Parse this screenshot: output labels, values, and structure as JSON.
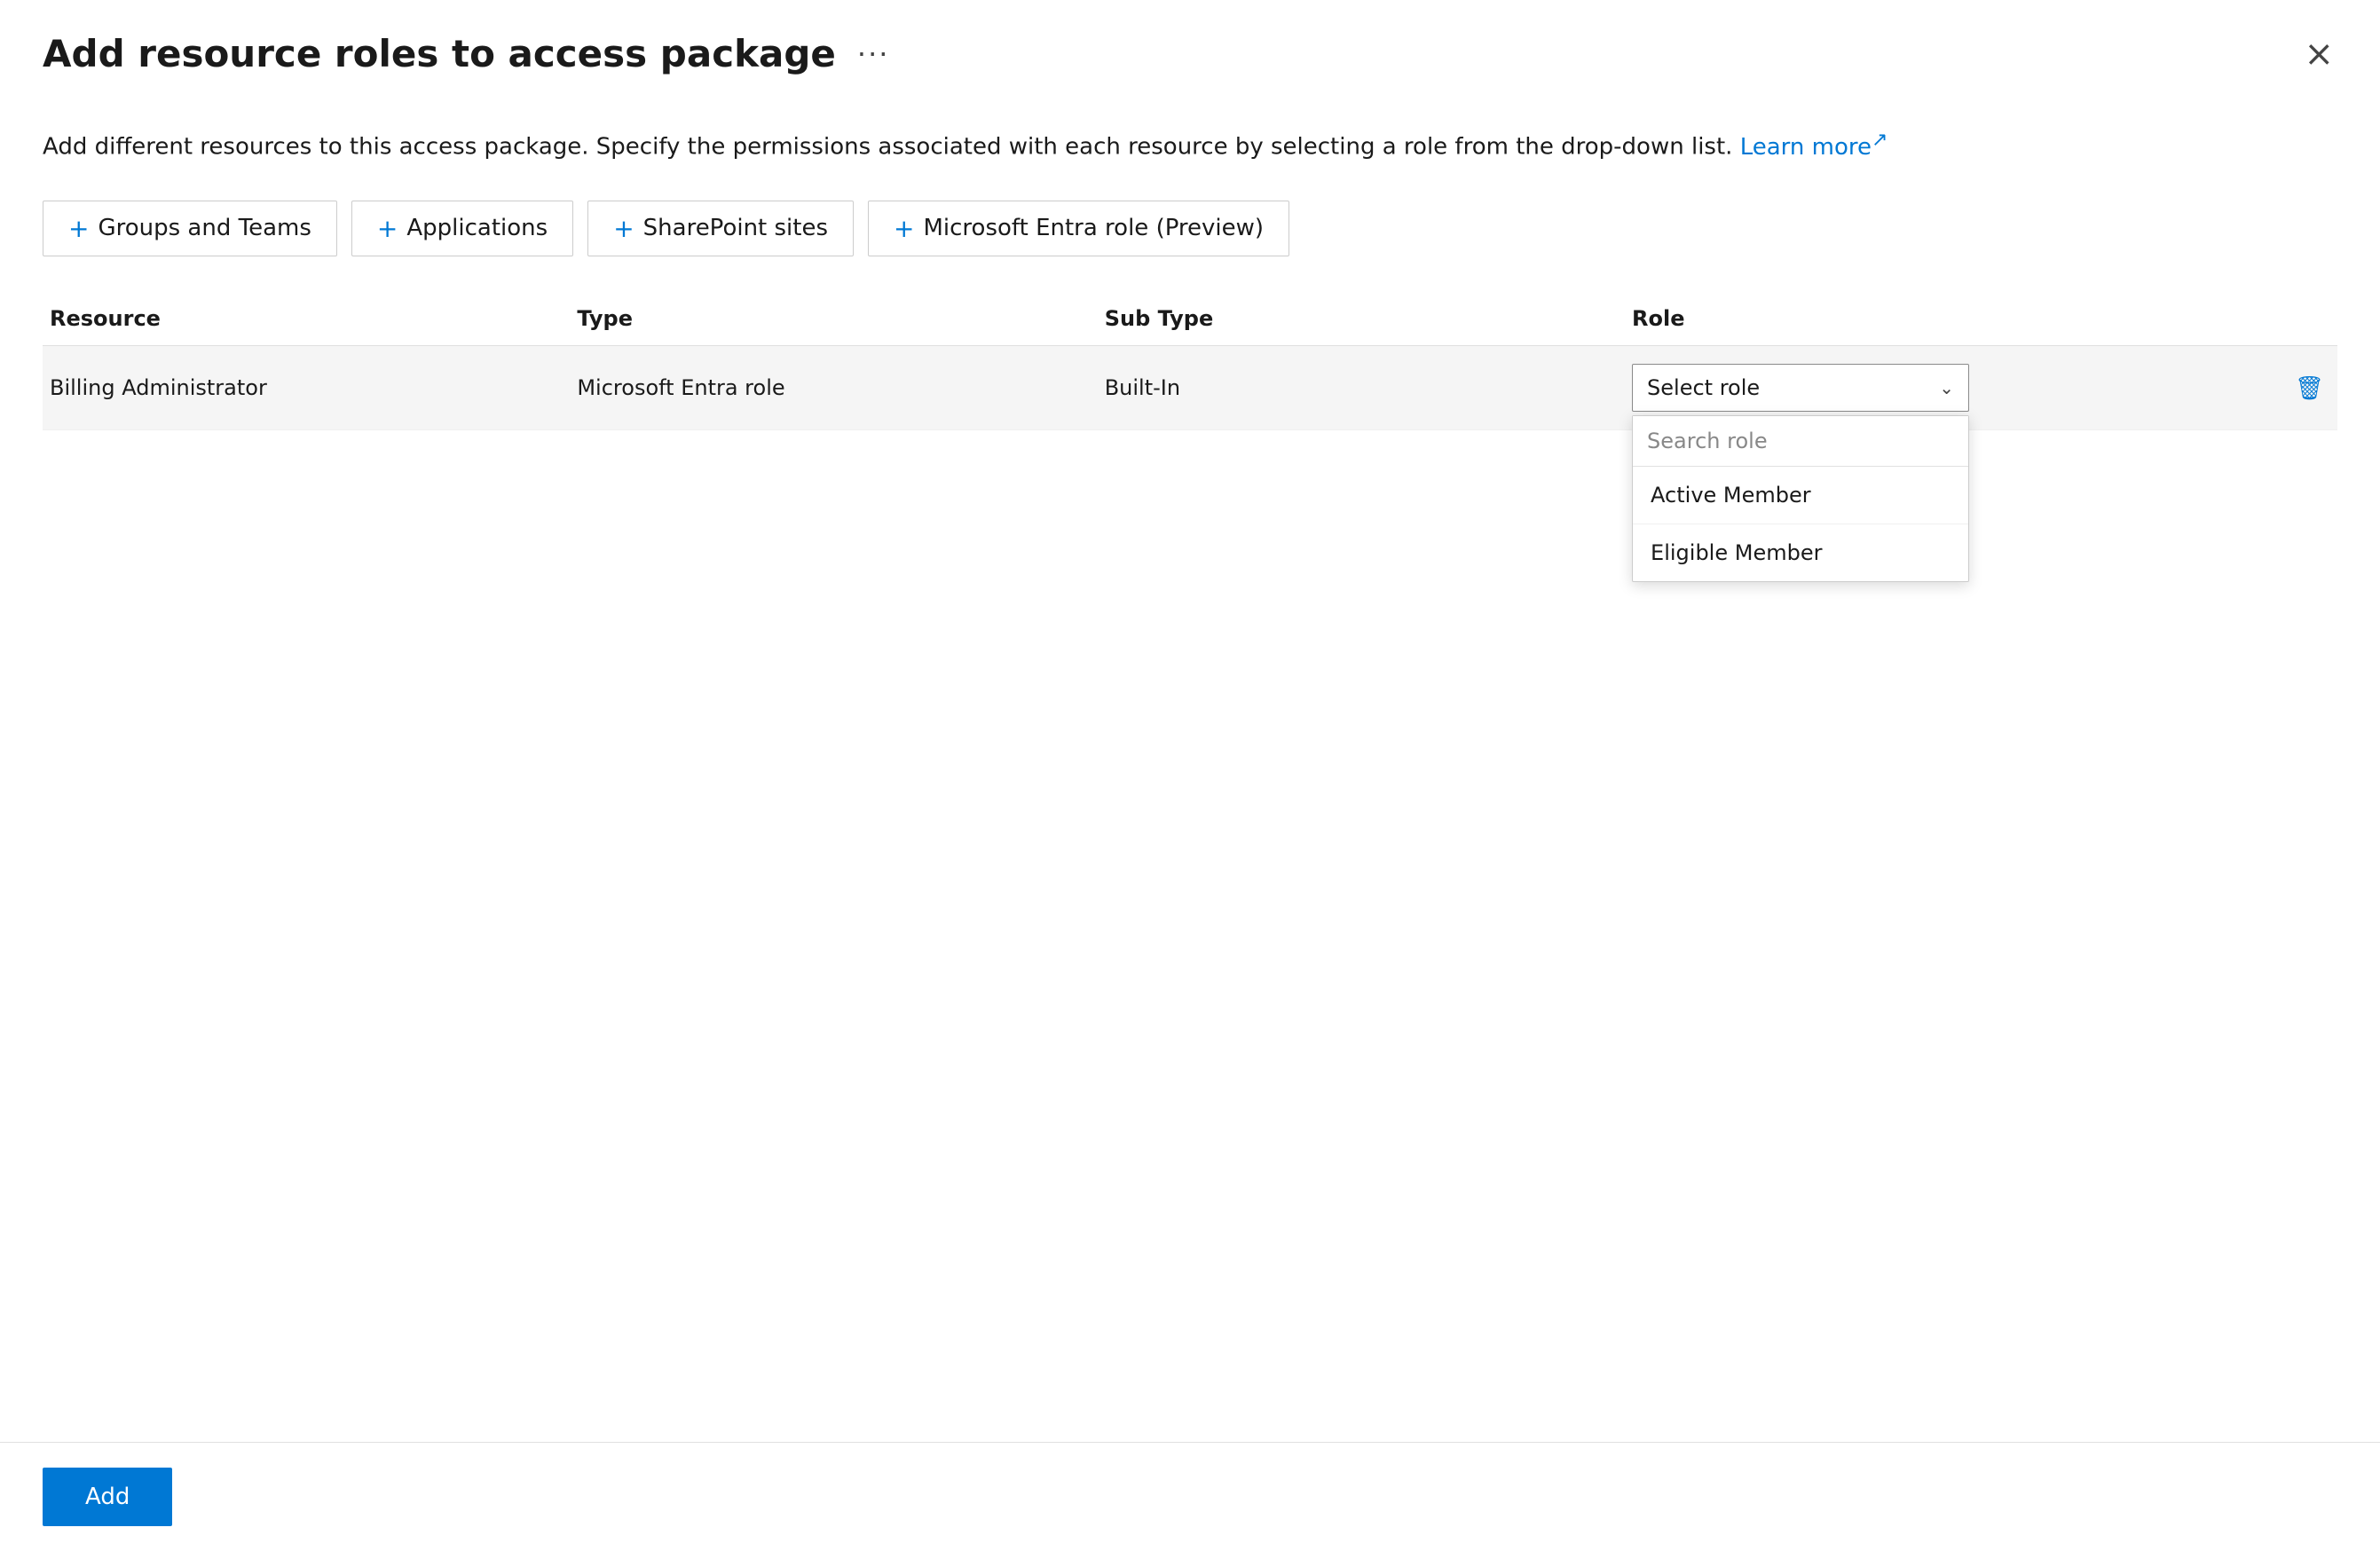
{
  "dialog": {
    "title": "Add resource roles to access package",
    "ellipsis_label": "···",
    "close_label": "×",
    "description_text": "Add different resources to this access package. Specify the permissions associated with each resource by selecting a role from the drop-down list.",
    "learn_more_label": "Learn more",
    "learn_more_ext_icon": "↗"
  },
  "tabs": [
    {
      "id": "groups-and-teams",
      "label": "Groups and Teams",
      "plus": "+"
    },
    {
      "id": "applications",
      "label": "Applications",
      "plus": "+"
    },
    {
      "id": "sharepoint-sites",
      "label": "SharePoint sites",
      "plus": "+"
    },
    {
      "id": "microsoft-entra-role",
      "label": "Microsoft Entra role (Preview)",
      "plus": "+"
    }
  ],
  "table": {
    "headers": [
      {
        "id": "resource",
        "label": "Resource"
      },
      {
        "id": "type",
        "label": "Type"
      },
      {
        "id": "sub-type",
        "label": "Sub Type"
      },
      {
        "id": "role",
        "label": "Role"
      }
    ],
    "rows": [
      {
        "resource": "Billing Administrator",
        "type": "Microsoft Entra role",
        "sub_type": "Built-In",
        "role_placeholder": "Select role"
      }
    ]
  },
  "role_dropdown": {
    "search_placeholder": "Search role",
    "options": [
      {
        "label": "Active Member"
      },
      {
        "label": "Eligible Member"
      }
    ]
  },
  "footer": {
    "add_label": "Add"
  }
}
